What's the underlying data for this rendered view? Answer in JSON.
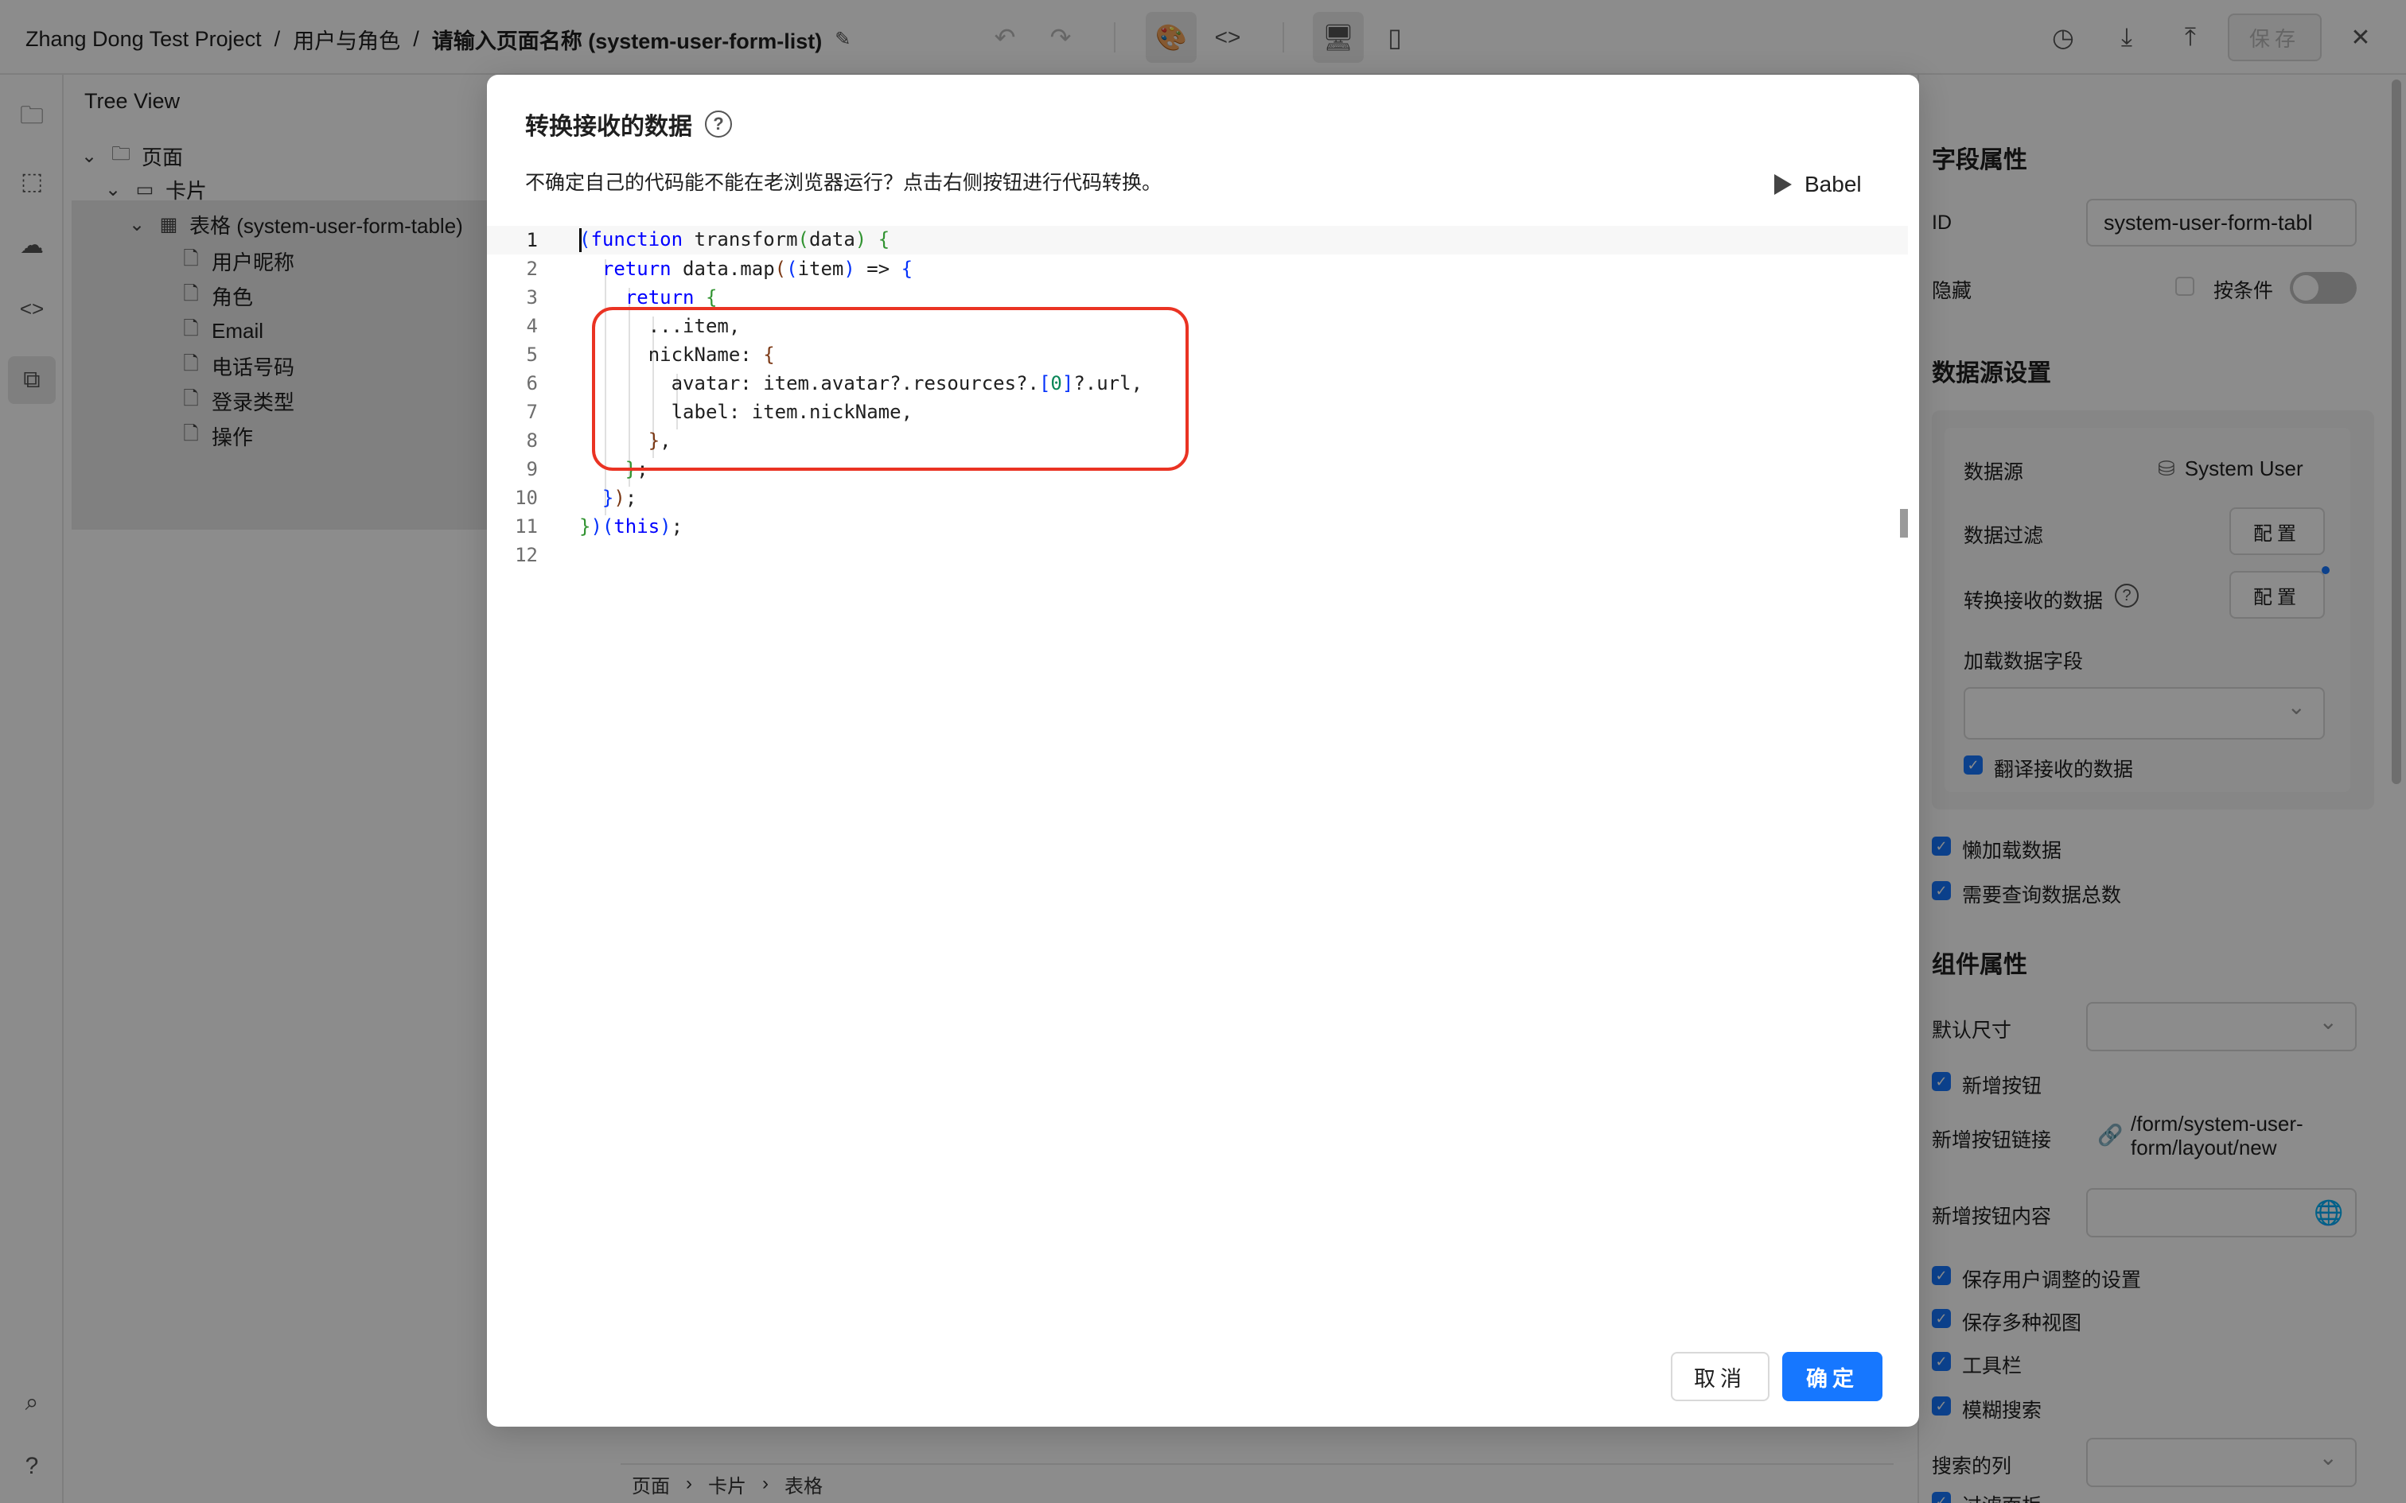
{
  "topbar": {
    "project": "Zhang Dong Test Project",
    "sep1": "/",
    "section": "用户与角色",
    "sep2": "/",
    "page": "请输入页面名称 (system-user-form-list)",
    "save_label": "保存"
  },
  "tree": {
    "title": "Tree View",
    "nodes": [
      {
        "label": "页面"
      },
      {
        "label": "卡片"
      },
      {
        "label": "表格 (system-user-form-table)"
      },
      {
        "label": "用户昵称"
      },
      {
        "label": "角色"
      },
      {
        "label": "Email"
      },
      {
        "label": "电话号码"
      },
      {
        "label": "登录类型"
      },
      {
        "label": "操作"
      }
    ]
  },
  "canvas_breadcrumb": [
    "页面",
    "卡片",
    "表格"
  ],
  "right_panel": {
    "field_props_heading": "字段属性",
    "id_label": "ID",
    "id_value": "system-user-form-tabl",
    "hidden_label": "隐藏",
    "conditional_label": "按条件",
    "datasource_heading": "数据源设置",
    "datasource_label": "数据源",
    "datasource_value": "System User",
    "filter_label": "数据过滤",
    "config_label": "配置",
    "transform_label": "转换接收的数据",
    "load_fields_label": "加载数据字段",
    "translate_label": "翻译接收的数据",
    "lazy_load_label": "懒加载数据",
    "query_total_label": "需要查询数据总数",
    "component_heading": "组件属性",
    "default_size_label": "默认尺寸",
    "add_button_label": "新增按钮",
    "add_link_label": "新增按钮链接",
    "add_link_value_line1": "/form/system-user-",
    "add_link_value_line2": "form/layout/new",
    "add_content_label": "新增按钮内容",
    "save_settings_label": "保存用户调整的设置",
    "save_views_label": "保存多种视图",
    "toolbar_label": "工具栏",
    "fuzzy_search_label": "模糊搜索",
    "search_columns_label": "搜索的列",
    "filter_panel_label": "过滤面板"
  },
  "modal": {
    "title": "转换接收的数据",
    "description": "不确定自己的代码能不能在老浏览器运行？点击右侧按钮进行代码转换。",
    "babel_label": "Babel",
    "cancel_label": "取消",
    "ok_label": "确定",
    "line_numbers": [
      "1",
      "2",
      "3",
      "4",
      "5",
      "6",
      "7",
      "8",
      "9",
      "10",
      "11",
      "12"
    ],
    "code_lines": [
      "(function transform(data) {",
      "  return data.map((item) => {",
      "    return {",
      "      ...item,",
      "      nickName: {",
      "        avatar: item.avatar?.resources?.[0]?.url,",
      "        label: item.nickName,",
      "      },",
      "    };",
      "  });",
      "})(this);",
      ""
    ]
  },
  "colors": {
    "accent": "#1677ff",
    "highlight": "#ea3323",
    "keyword": "#0000ff"
  }
}
